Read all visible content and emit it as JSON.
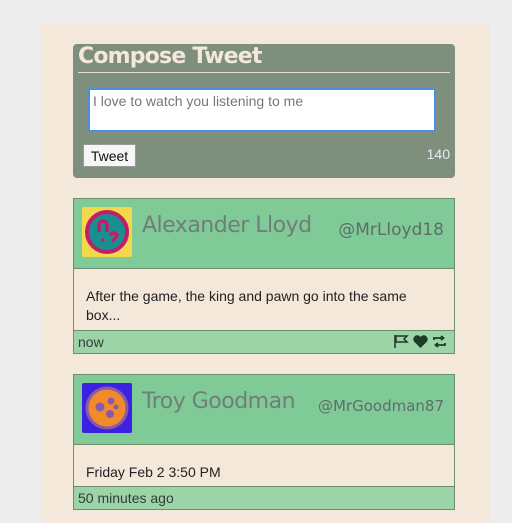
{
  "compose": {
    "title": "Compose Tweet",
    "text_value": "I love to watch you listening to me",
    "button_label": "Tweet",
    "char_count": "140"
  },
  "tweets": [
    {
      "name": "Alexander Lloyd",
      "handle": "@MrLloyd18",
      "body": "After the game, the king and pawn go into the same box...",
      "time": "now",
      "avatar_icon": "face-avatar-icon",
      "avatar_bg": "#f2d84b",
      "avatar_fg": "#1a8f8f",
      "actions": [
        "flag-icon",
        "heart-icon",
        "retweet-icon"
      ]
    },
    {
      "name": "Troy Goodman",
      "handle": "@MrGoodman87",
      "body": "Friday Feb 2 3:50 PM",
      "time": "50 minutes ago",
      "avatar_icon": "cookie-avatar-icon",
      "avatar_bg": "#3a22e0",
      "avatar_fg": "#f08a2a"
    }
  ],
  "colors": {
    "page_bg": "#f4e8da",
    "compose_bg": "#7e8f7e",
    "card_header": "#80ca97",
    "card_footer": "#9cd3a7"
  }
}
